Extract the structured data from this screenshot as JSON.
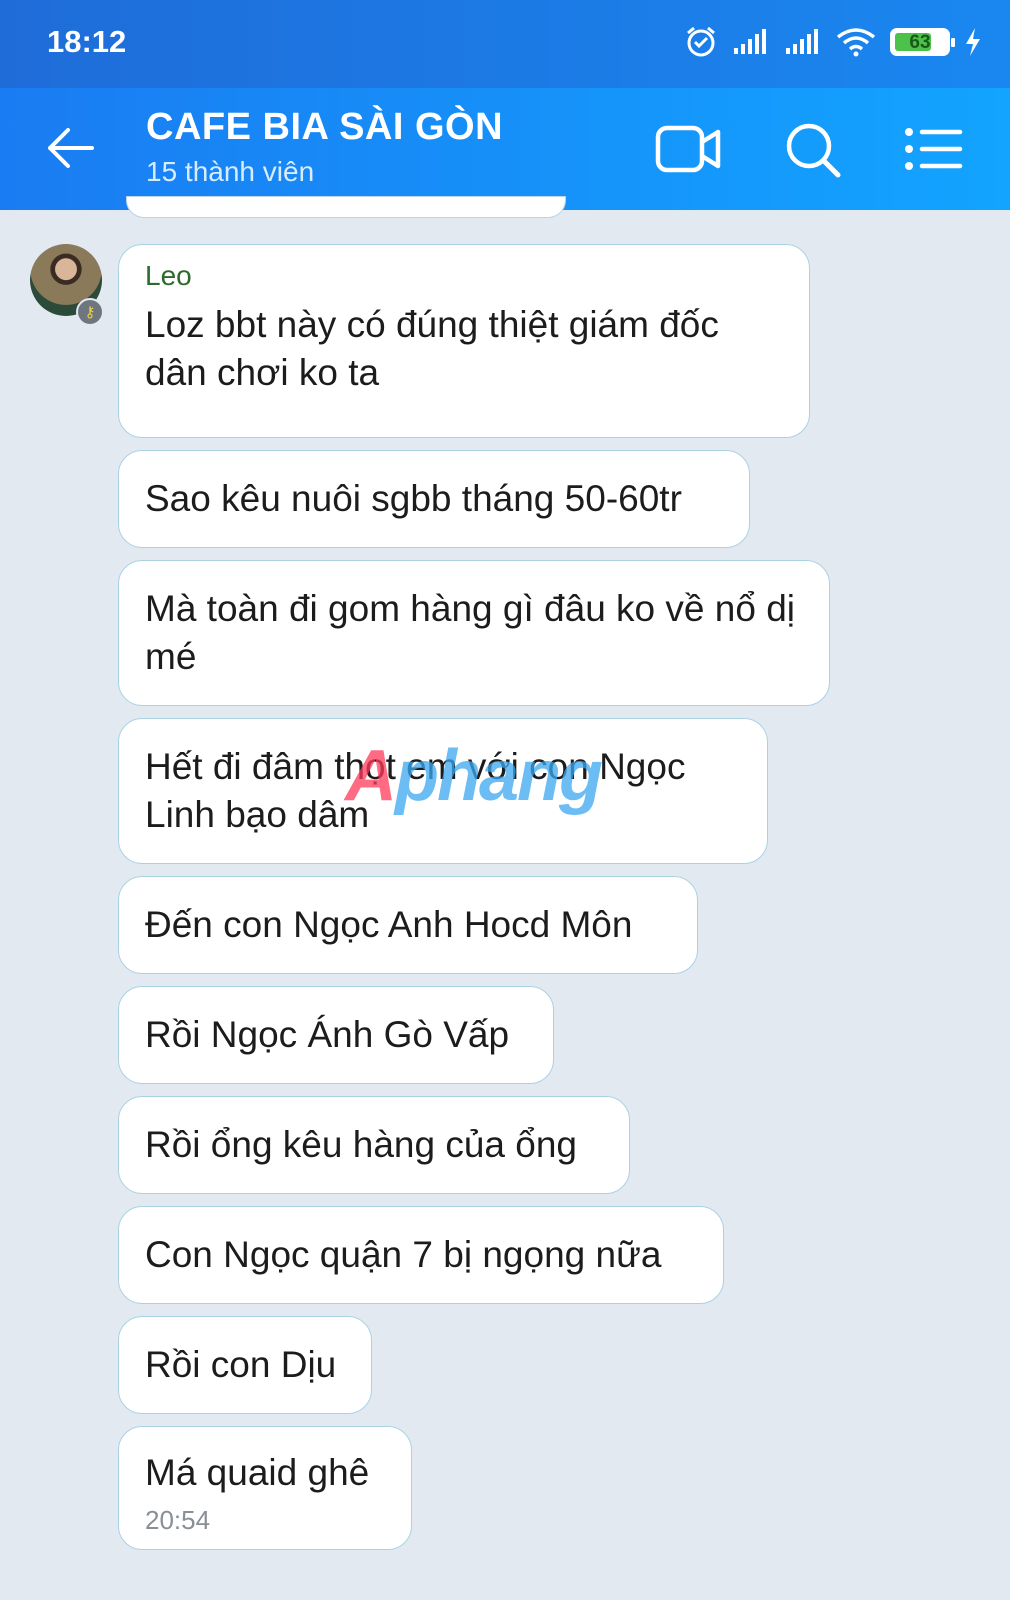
{
  "status_bar": {
    "time": "18:12",
    "battery": "63",
    "icons": [
      "alarm-icon",
      "signal-icon",
      "signal-icon",
      "wifi-icon",
      "battery-icon",
      "charging-icon"
    ]
  },
  "header": {
    "title": "CAFE BIA SÀI GÒN",
    "subtitle": "15 thành viên",
    "icons": [
      "back-arrow-icon",
      "video-call-icon",
      "search-icon",
      "menu-list-icon"
    ]
  },
  "conversation": {
    "sender": "Leo",
    "messages": [
      "Loz bbt này có đúng thiệt giám đốc dân chơi ko ta",
      "Sao kêu nuôi sgbb tháng 50-60tr",
      "Mà toàn đi gom hàng gì đâu ko về nổ dị mé",
      "Hết đi đâm thọt em với con Ngọc Linh bạo dâm",
      "Đến con Ngọc Anh Hocd Môn",
      "Rồi Ngọc Ánh Gò Vấp",
      "Rồi ổng kêu hàng của ổng",
      "Con Ngọc quận 7 bị ngọng nữa",
      "Rồi con Dịu",
      "Má quaid ghê"
    ],
    "last_time": "20:54"
  },
  "watermark": {
    "first": "A",
    "rest": "phang"
  },
  "colors": {
    "header_start": "#1a7cf2",
    "header_end": "#12a4ff",
    "background": "#e2e9f1",
    "bubble_border": "#a9d3e2",
    "sender_name": "#2d6b2d"
  }
}
